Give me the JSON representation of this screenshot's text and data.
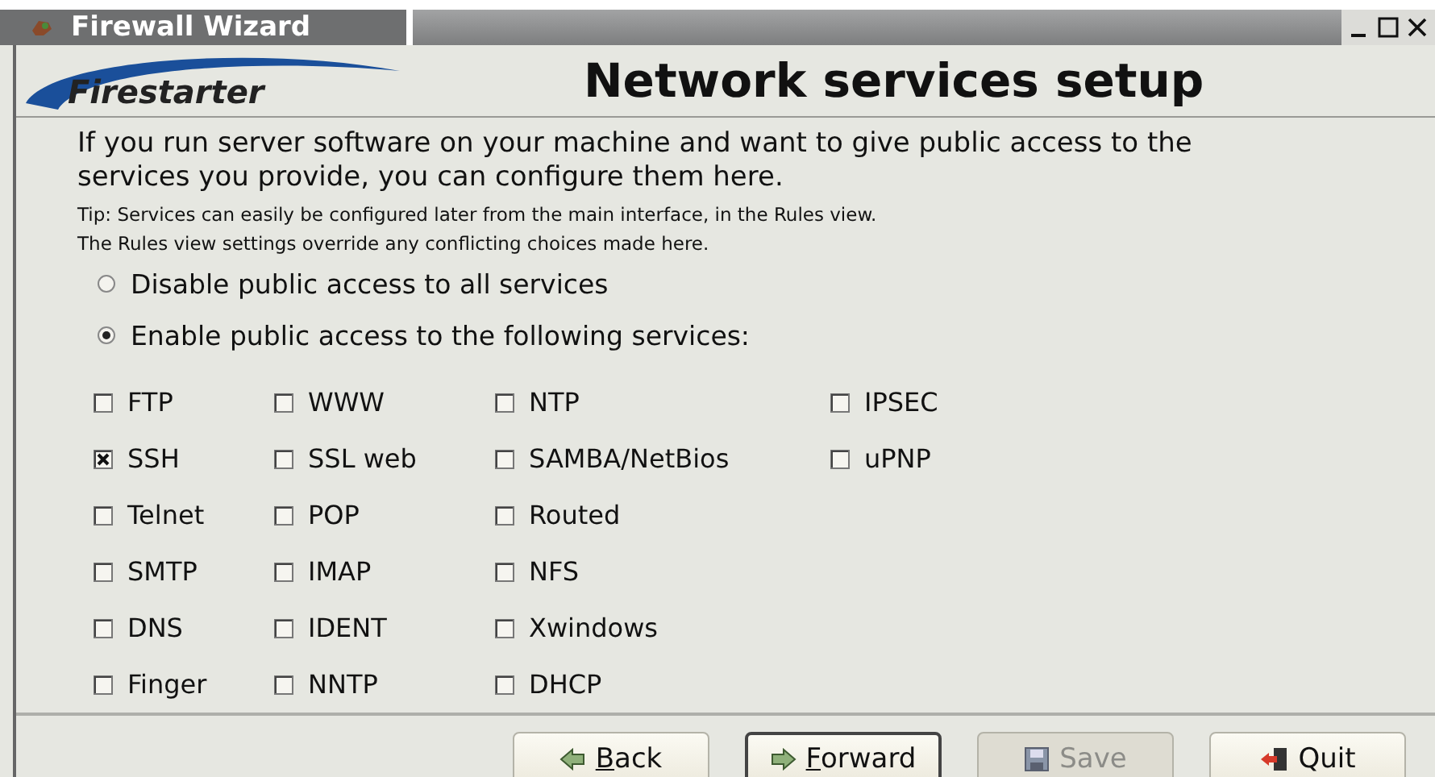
{
  "window": {
    "title": "Firewall Wizard"
  },
  "header": {
    "logo_text": "Firestarter",
    "title": "Network services setup"
  },
  "intro": "If you run server software on your machine and want to give public access to the services you provide, you can configure them here.",
  "tip": [
    "Tip: Services can easily be configured later from the main interface, in the Rules view.",
    "The Rules view settings override any conflicting choices made here."
  ],
  "access_options": [
    {
      "label": "Disable public access to all services",
      "selected": false
    },
    {
      "label": "Enable public access to the following services:",
      "selected": true
    }
  ],
  "services": [
    [
      {
        "label": "FTP",
        "checked": false
      },
      {
        "label": "WWW",
        "checked": false
      },
      {
        "label": "NTP",
        "checked": false
      },
      {
        "label": "IPSEC",
        "checked": false
      }
    ],
    [
      {
        "label": "SSH",
        "checked": true
      },
      {
        "label": "SSL web",
        "checked": false
      },
      {
        "label": "SAMBA/NetBios",
        "checked": false
      },
      {
        "label": "uPNP",
        "checked": false
      }
    ],
    [
      {
        "label": "Telnet",
        "checked": false
      },
      {
        "label": "POP",
        "checked": false
      },
      {
        "label": "Routed",
        "checked": false
      }
    ],
    [
      {
        "label": "SMTP",
        "checked": false
      },
      {
        "label": "IMAP",
        "checked": false
      },
      {
        "label": "NFS",
        "checked": false
      }
    ],
    [
      {
        "label": "DNS",
        "checked": false
      },
      {
        "label": "IDENT",
        "checked": false
      },
      {
        "label": "Xwindows",
        "checked": false
      }
    ],
    [
      {
        "label": "Finger",
        "checked": false
      },
      {
        "label": "NNTP",
        "checked": false
      },
      {
        "label": "DHCP",
        "checked": false
      }
    ]
  ],
  "buttons": [
    {
      "label": "Back",
      "kind": "back",
      "underline_first": true,
      "disabled": false,
      "focused": false
    },
    {
      "label": "Forward",
      "kind": "forward",
      "underline_first": true,
      "disabled": false,
      "focused": true
    },
    {
      "label": "Save",
      "kind": "save",
      "underline_first": false,
      "disabled": true,
      "focused": false
    },
    {
      "label": "Quit",
      "kind": "quit",
      "underline_first": false,
      "disabled": false,
      "focused": false
    }
  ]
}
